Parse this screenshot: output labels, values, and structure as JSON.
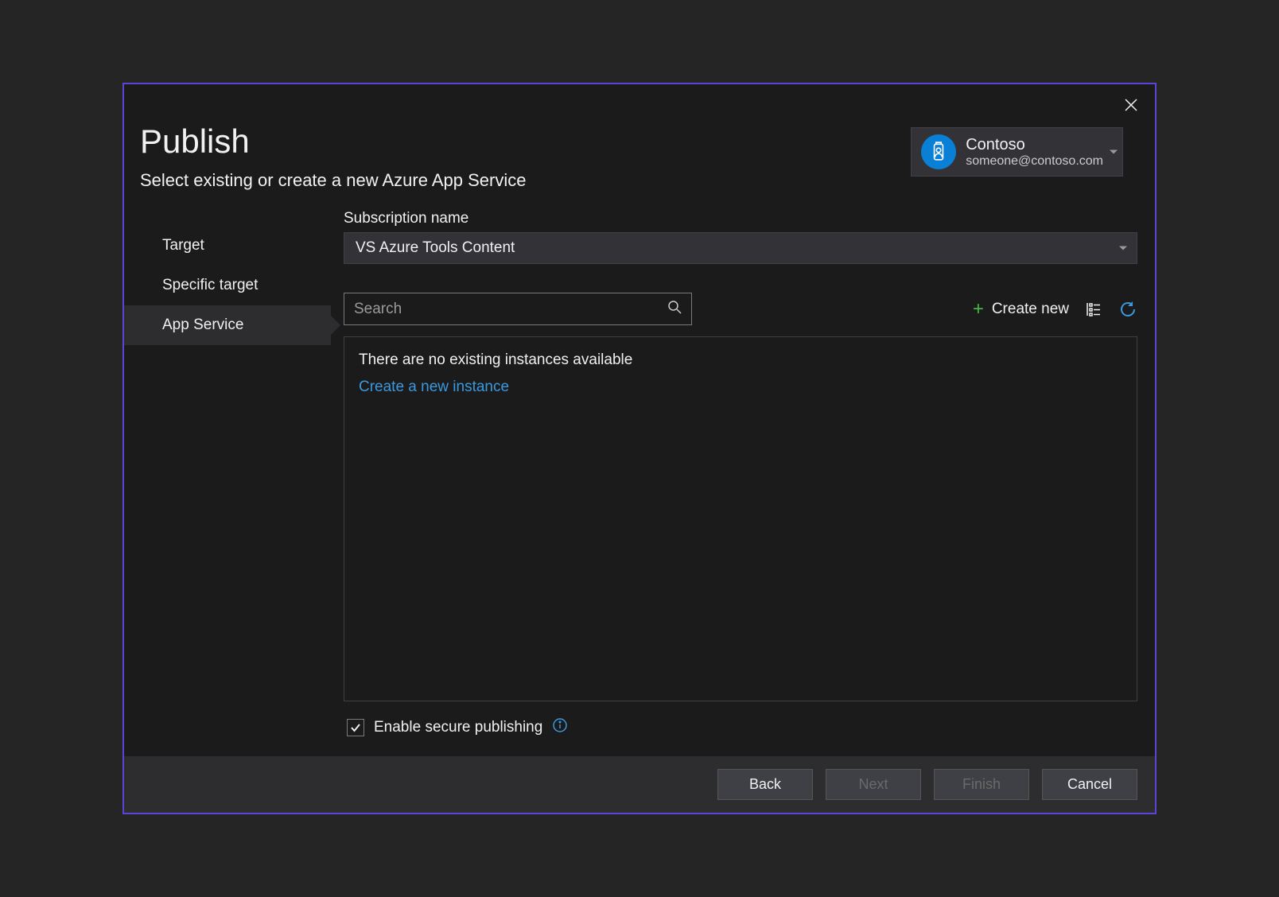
{
  "title": "Publish",
  "subtitle": "Select existing or create a new Azure App Service",
  "account": {
    "name": "Contoso",
    "email": "someone@contoso.com"
  },
  "sidebar": {
    "items": [
      {
        "label": "Target"
      },
      {
        "label": "Specific target"
      },
      {
        "label": "App Service"
      }
    ]
  },
  "subscription": {
    "label": "Subscription name",
    "value": "VS Azure Tools Content"
  },
  "search": {
    "placeholder": "Search"
  },
  "toolbar": {
    "create_new": "Create new"
  },
  "panel": {
    "empty_message": "There are no existing instances available",
    "create_link": "Create a new instance"
  },
  "checkbox": {
    "label": "Enable secure publishing",
    "checked": true
  },
  "buttons": {
    "back": "Back",
    "next": "Next",
    "finish": "Finish",
    "cancel": "Cancel"
  }
}
